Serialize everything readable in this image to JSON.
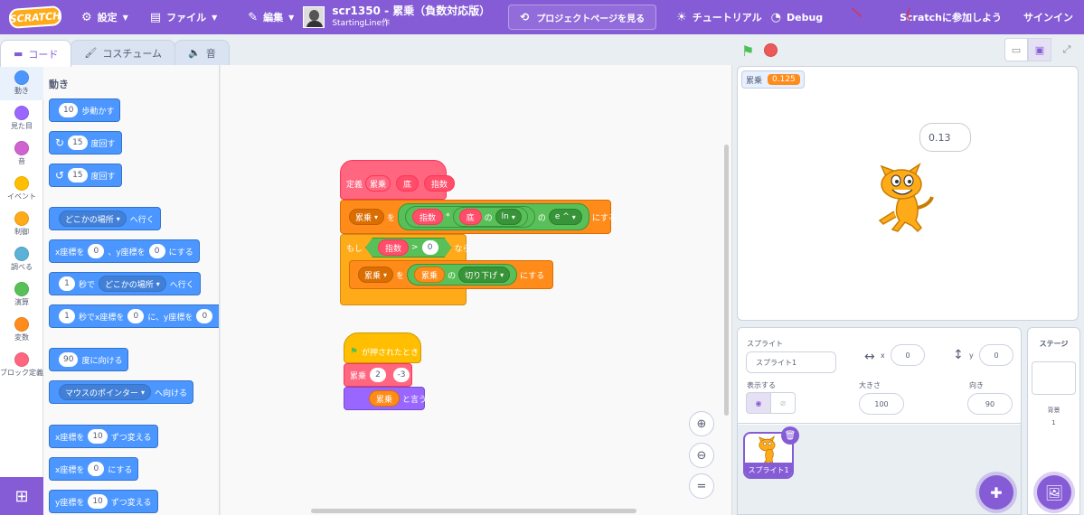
{
  "menubar": {
    "logo": "SCRATCH",
    "settings": "設定",
    "file": "ファイル",
    "edit": "編集",
    "project_title": "scr1350 - 累乗（負数対応版）",
    "author": "StartingLine作",
    "see_project": "プロジェクトページを見る",
    "tutorials": "チュートリアル",
    "debug": "Debug",
    "join": "Scratchに参加しよう",
    "signin": "サインイン"
  },
  "tabs": {
    "code": "コード",
    "costumes": "コスチューム",
    "sounds": "音"
  },
  "categories": [
    {
      "label": "動き",
      "color": "#4c97ff"
    },
    {
      "label": "見た目",
      "color": "#9966ff"
    },
    {
      "label": "音",
      "color": "#cf63cf"
    },
    {
      "label": "イベント",
      "color": "#ffbf00"
    },
    {
      "label": "制御",
      "color": "#ffab19"
    },
    {
      "label": "調べる",
      "color": "#5cb1d6"
    },
    {
      "label": "演算",
      "color": "#59c059"
    },
    {
      "label": "変数",
      "color": "#ff8c1a"
    },
    {
      "label": "ブロック定義",
      "color": "#ff6680"
    }
  ],
  "palette": {
    "heading": "動き",
    "move": {
      "value": "10",
      "text": "歩動かす"
    },
    "turn_right": {
      "value": "15",
      "text": "度回す"
    },
    "turn_left": {
      "value": "15",
      "text": "度回す"
    },
    "goto": {
      "menu": "どこかの場所",
      "text": "へ行く"
    },
    "gotoxy": {
      "a": "x座標を",
      "x": "0",
      "b": "、y座標を",
      "y": "0",
      "c": "にする"
    },
    "glide": {
      "value": "1",
      "a": "秒で",
      "menu": "どこかの場所",
      "b": "へ行く"
    },
    "glidexy": {
      "value": "1",
      "a": "秒でx座標を",
      "x": "0",
      "b": "に、y座標を",
      "y": "0"
    },
    "point": {
      "value": "90",
      "text": "度に向ける"
    },
    "point_towards": {
      "menu": "マウスのポインター",
      "text": "へ向ける"
    },
    "change_x": {
      "a": "x座標を",
      "value": "10",
      "b": "ずつ変える"
    },
    "set_x": {
      "a": "x座標を",
      "value": "0",
      "b": "にする"
    },
    "change_y": {
      "a": "y座標を",
      "value": "10",
      "b": "ずつ変える"
    }
  },
  "script1": {
    "define": "定義",
    "name": "累乗",
    "arg1": "底",
    "arg2": "指数",
    "set_var": "累乗",
    "set_wo": "を",
    "mul": "*",
    "no1": "の",
    "ln": "ln",
    "no2": "の",
    "exp": "e ^",
    "ni_suru": "にする",
    "if": "もし",
    "gt": ">",
    "zero": "0",
    "nara": "なら",
    "set2_var": "累乗",
    "set2_wo": "を",
    "var": "累乗",
    "no3": "の",
    "floor": "切り下げ",
    "ni_suru2": "にする"
  },
  "script2": {
    "hat": "が押されたとき",
    "call": "累乗",
    "a": "2",
    "b": "-3",
    "var": "累乗",
    "say": "と言う"
  },
  "monitor": {
    "name": "累乗",
    "value": "0.125"
  },
  "bubble": "0.13",
  "sprite": {
    "label": "スプライト",
    "name": "スプライト1",
    "x_label": "x",
    "x": "0",
    "y_label": "y",
    "y": "0",
    "show_label": "表示する",
    "size_label": "大きさ",
    "size": "100",
    "dir_label": "向き",
    "direction": "90",
    "thumb_name": "スプライト1"
  },
  "stage_panel": {
    "title": "ステージ",
    "backdrop_label": "背景",
    "backdrop_count": "1"
  }
}
